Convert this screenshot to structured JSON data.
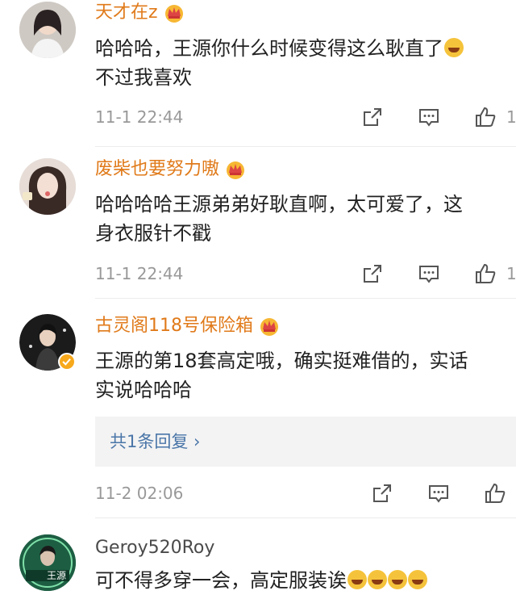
{
  "comments": [
    {
      "username": "天才在z",
      "text_lines": [
        "哈哈哈，王源你什么时候变得这么耿直了",
        "不过我喜欢"
      ],
      "time": "11-1 22:44",
      "like_count": "1"
    },
    {
      "username": "废柴也要努力嗷",
      "text_lines": [
        "哈哈哈哈王源弟弟好耿直啊，太可爱了，这",
        "身衣服针不戳"
      ],
      "time": "11-1 22:44",
      "like_count": "1"
    },
    {
      "username": "古灵阁118号保险箱",
      "text_lines": [
        "王源的第18套高定哦，确实挺难借的，实话",
        "实说哈哈哈"
      ],
      "reply_link": "共1条回复 ›",
      "time": "11-2 02:06",
      "like_count": ""
    },
    {
      "username": "Geroy520Roy",
      "text_lines": [
        "可不得多穿一会，高定服装诶"
      ],
      "avatar_text": "王源"
    }
  ],
  "colors": {
    "username_vip": "#e07a1a",
    "username_normal": "#4a4a4a",
    "meta": "#999999",
    "link": "#4a76a8"
  },
  "icons": [
    "crown-icon",
    "share-icon",
    "comment-icon",
    "like-icon",
    "verified-icon",
    "laughing-emoji-icon"
  ]
}
